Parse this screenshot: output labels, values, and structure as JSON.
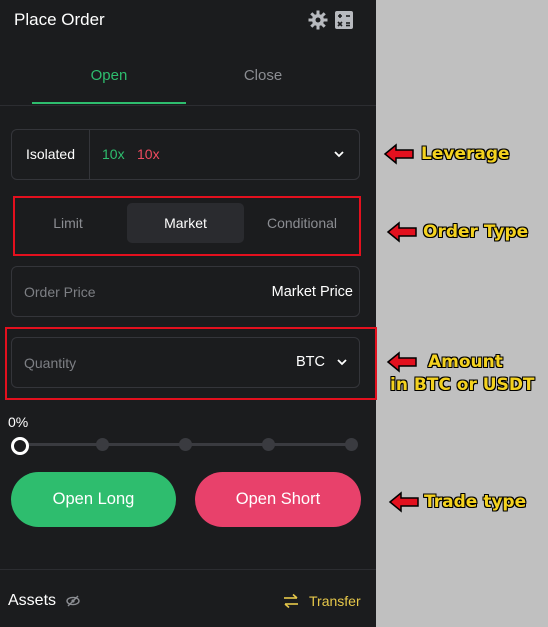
{
  "header": {
    "title": "Place Order",
    "icons": [
      "gear-icon",
      "calculator-icon"
    ]
  },
  "tabs": [
    {
      "label": "Open",
      "active": true
    },
    {
      "label": "Close",
      "active": false
    }
  ],
  "leverage": {
    "mode": "Isolated",
    "long": "10x",
    "short": "10x"
  },
  "order_types": [
    {
      "label": "Limit"
    },
    {
      "label": "Market",
      "selected": true
    },
    {
      "label": "Conditional"
    }
  ],
  "order_price": {
    "label": "Order Price",
    "value": "Market Price"
  },
  "quantity": {
    "placeholder": "Quantity",
    "unit": "BTC"
  },
  "slider": {
    "percent_label": "0%",
    "value_pct": 0
  },
  "actions": {
    "long": "Open Long",
    "short": "Open Short"
  },
  "footer": {
    "assets": "Assets",
    "transfer": "Transfer"
  },
  "annotations": {
    "leverage": "Leverage",
    "order_type": "Order Type",
    "amount_line1": "Amount",
    "amount_line2": "in BTC or USDT",
    "trade_type": "Trade type"
  },
  "colors": {
    "long": "#2ebd6e",
    "short": "#e8416b",
    "accent_transfer": "#e7c84a",
    "annotation": "#f4d21f",
    "annotation_box": "#e3101e"
  }
}
